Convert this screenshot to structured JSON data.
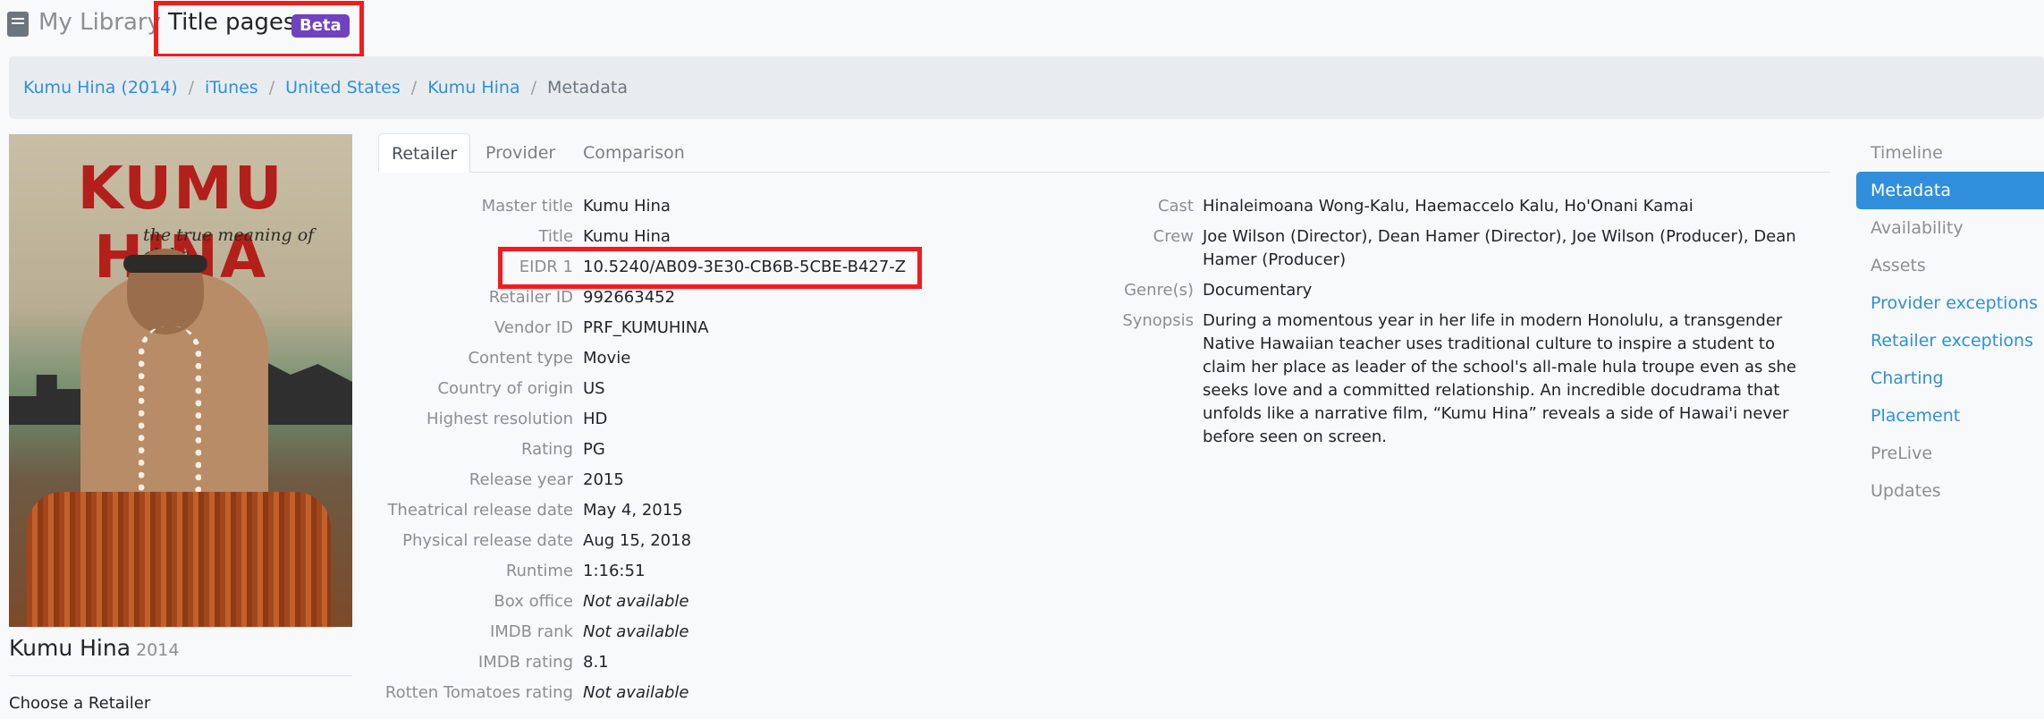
{
  "header": {
    "library_label": "My Library",
    "title_pages_label": "Title pages",
    "badge": "Beta"
  },
  "breadcrumb": [
    {
      "label": "Kumu Hina (2014)"
    },
    {
      "label": "iTunes"
    },
    {
      "label": "United States"
    },
    {
      "label": "Kumu Hina"
    },
    {
      "label": "Metadata"
    }
  ],
  "poster": {
    "title": "KUMU HINA",
    "tagline": "the true meaning of aloha"
  },
  "movie": {
    "title": "Kumu Hina",
    "year": "2014",
    "choose_retailer": "Choose a Retailer"
  },
  "tabs": [
    {
      "label": "Retailer"
    },
    {
      "label": "Provider"
    },
    {
      "label": "Comparison"
    }
  ],
  "metadata_left": [
    {
      "label": "Master title",
      "value": "Kumu Hina"
    },
    {
      "label": "Title",
      "value": "Kumu Hina"
    },
    {
      "label": "EIDR 1",
      "value": "10.5240/AB09-3E30-CB6B-5CBE-B427-Z"
    },
    {
      "label": "Retailer ID",
      "value": "992663452"
    },
    {
      "label": "Vendor ID",
      "value": "PRF_KUMUHINA"
    },
    {
      "label": "Content type",
      "value": "Movie"
    },
    {
      "label": "Country of origin",
      "value": "US"
    },
    {
      "label": "Highest resolution",
      "value": "HD"
    },
    {
      "label": "Rating",
      "value": "PG"
    },
    {
      "label": "Release year",
      "value": "2015"
    },
    {
      "label": "Theatrical release date",
      "value": "May 4, 2015"
    },
    {
      "label": "Physical release date",
      "value": "Aug 15, 2018"
    },
    {
      "label": "Runtime",
      "value": "1:16:51"
    },
    {
      "label": "Box office",
      "value": "Not available"
    },
    {
      "label": "IMDB rank",
      "value": "Not available"
    },
    {
      "label": "IMDB rating",
      "value": "8.1"
    },
    {
      "label": "Rotten Tomatoes rating",
      "value": "Not available"
    }
  ],
  "metadata_right": [
    {
      "label": "Cast",
      "value": "Hinaleimoana Wong-Kalu, Haemaccelo Kalu, Ho'Onani Kamai"
    },
    {
      "label": "Crew",
      "value": "Joe Wilson (Director), Dean Hamer (Director), Joe Wilson (Producer), Dean Hamer (Producer)"
    },
    {
      "label": "Genre(s)",
      "value": "Documentary"
    },
    {
      "label": "Synopsis",
      "value": "During a momentous year in her life in modern Honolulu, a transgender Native Hawaiian teacher uses traditional culture to inspire a student to claim her place as leader of the school's all-male hula troupe even as she seeks love and a committed relationship. An incredible docudrama that unfolds like a narrative film, “Kumu Hina” reveals a side of Hawai'i never before seen on screen."
    }
  ],
  "side_nav": [
    {
      "label": "Timeline"
    },
    {
      "label": "Metadata"
    },
    {
      "label": "Availability"
    },
    {
      "label": "Assets"
    },
    {
      "label": "Provider exceptions"
    },
    {
      "label": "Retailer exceptions"
    },
    {
      "label": "Charting"
    },
    {
      "label": "Placement"
    },
    {
      "label": "PreLive"
    },
    {
      "label": "Updates"
    }
  ],
  "colors": {
    "accent": "#2f8fdc",
    "badge": "#6f42c1",
    "highlight": "#f21c1c"
  }
}
